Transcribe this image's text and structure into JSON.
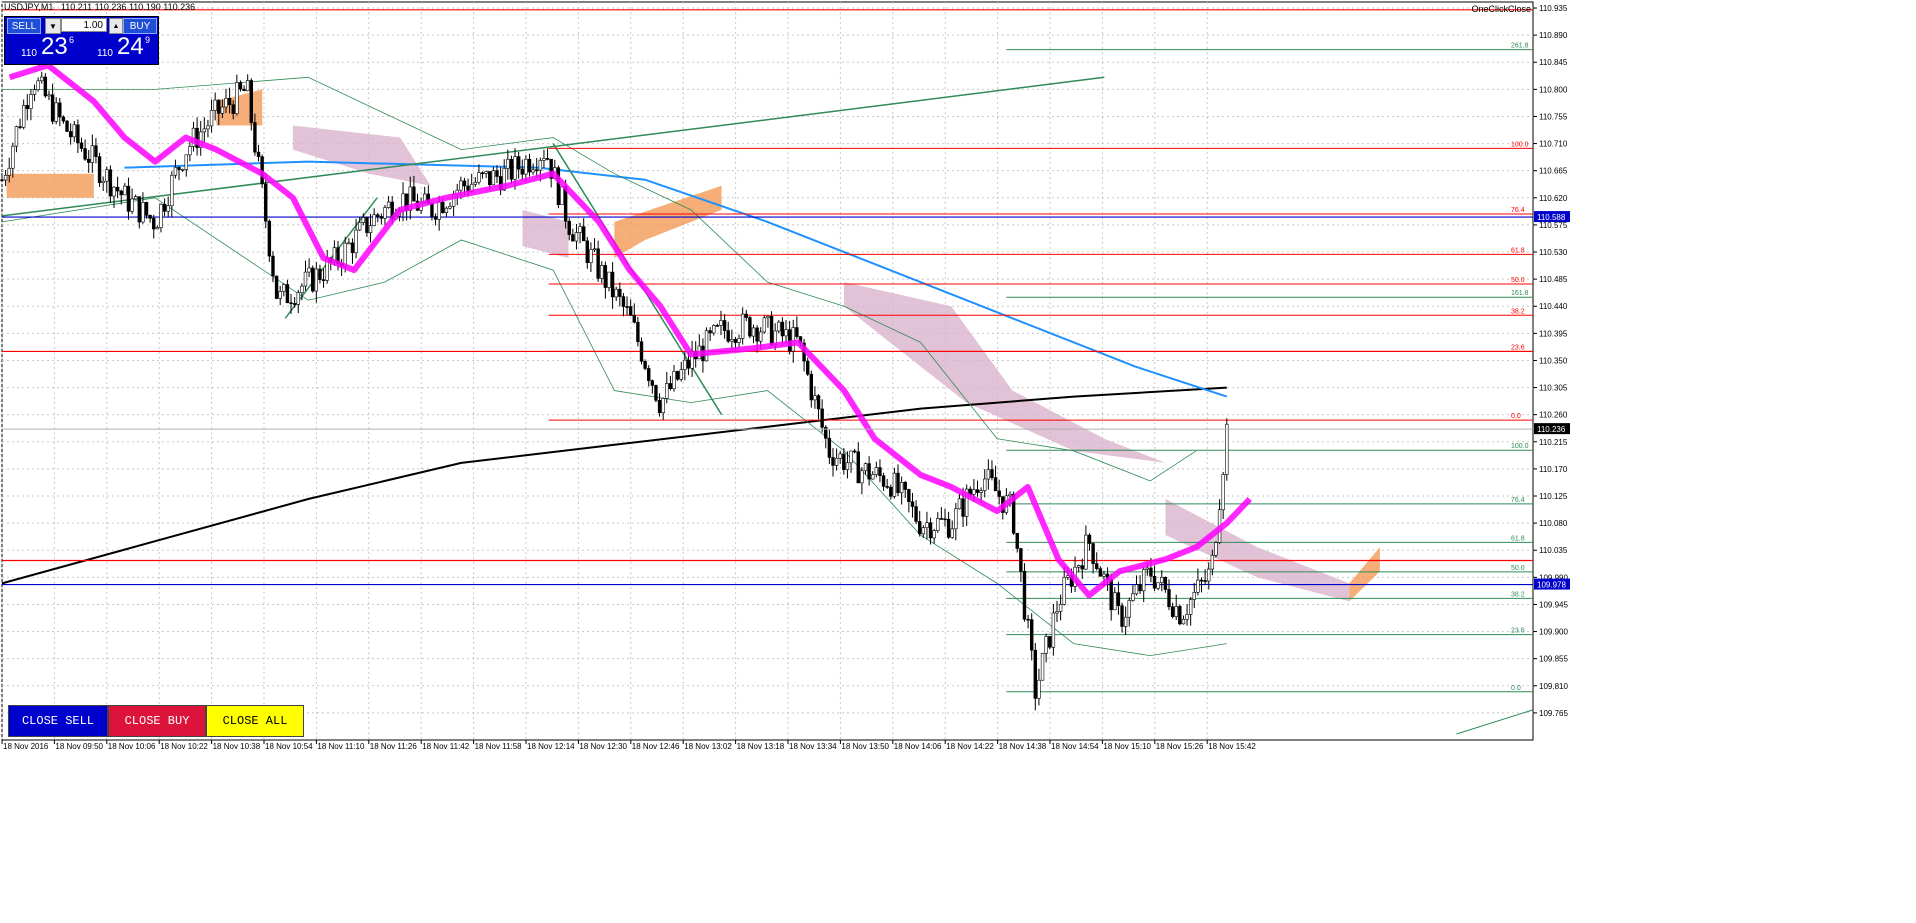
{
  "header": {
    "symbol": "USDJPY,M1",
    "ohlc": "110.211 110.236 110.190 110.236"
  },
  "one_click_label": "OneClickClose",
  "trade_panel": {
    "sell_label": "SELL",
    "buy_label": "BUY",
    "lot": "1.00",
    "dropdown_glyph": "▼",
    "up_glyph": "▲",
    "sell_small": "110",
    "sell_big": "23",
    "sell_sup": "6",
    "buy_small": "110",
    "buy_big": "24",
    "buy_sup": "9"
  },
  "buttons": {
    "close_sell": "CLOSE SELL",
    "close_buy": "CLOSE BUY",
    "close_all": "CLOSE ALL"
  },
  "colors": {
    "sell": "#0000cc",
    "close_buy": "#dc143c",
    "close_all": "#ffff00",
    "bid_line": "#0000cc"
  },
  "chart_data": {
    "type": "candlestick",
    "symbol": "USDJPY",
    "timeframe": "M1",
    "ylim": [
      109.72,
      110.945
    ],
    "grid": true,
    "y_ticks": [
      "110.935",
      "110.890",
      "110.845",
      "110.800",
      "110.755",
      "110.710",
      "110.665",
      "110.620",
      "110.575",
      "110.530",
      "110.485",
      "110.440",
      "110.395",
      "110.350",
      "110.305",
      "110.260",
      "110.215",
      "110.170",
      "110.125",
      "110.080",
      "110.035",
      "109.990",
      "109.945",
      "109.900",
      "109.855",
      "109.810",
      "109.765"
    ],
    "x_ticks": [
      "18 Nov 2016",
      "18 Nov 09:50",
      "18 Nov 10:06",
      "18 Nov 10:22",
      "18 Nov 10:38",
      "18 Nov 10:54",
      "18 Nov 11:10",
      "18 Nov 11:26",
      "18 Nov 11:42",
      "18 Nov 11:58",
      "18 Nov 12:14",
      "18 Nov 12:30",
      "18 Nov 12:46",
      "18 Nov 13:02",
      "18 Nov 13:18",
      "18 Nov 13:34",
      "18 Nov 13:50",
      "18 Nov 14:06",
      "18 Nov 14:22",
      "18 Nov 14:38",
      "18 Nov 14:54",
      "18 Nov 15:10",
      "18 Nov 15:26",
      "18 Nov 15:42"
    ],
    "current_price": "110.236",
    "price_labels": [
      {
        "value": 110.588,
        "label": "110.588",
        "color": "#0000cc"
      },
      {
        "value": 109.978,
        "label": "109.978",
        "color": "#0000cc"
      },
      {
        "value": 110.236,
        "label": "110.236",
        "color": "#000000"
      }
    ],
    "horizontal_lines": [
      {
        "value": 110.932,
        "color": "#ff0000"
      },
      {
        "value": 110.365,
        "color": "#ff0000"
      },
      {
        "value": 110.018,
        "color": "#ff0000"
      },
      {
        "value": 110.588,
        "color": "#0000cc"
      },
      {
        "value": 109.978,
        "color": "#0000cc"
      }
    ],
    "fib_red": {
      "levels": [
        {
          "label": "100.0",
          "value": 110.702
        },
        {
          "label": "76.4",
          "value": 110.593
        },
        {
          "label": "61.8",
          "value": 110.526
        },
        {
          "label": "50.0",
          "value": 110.477
        },
        {
          "label": "38.2",
          "value": 110.425
        },
        {
          "label": "23.6",
          "value": 110.365
        },
        {
          "label": "0.0",
          "value": 110.251
        }
      ]
    },
    "fib_green": {
      "levels": [
        {
          "label": "261.8",
          "value": 110.866
        },
        {
          "label": "161.8",
          "value": 110.455
        },
        {
          "label": "100.0",
          "value": 110.201
        },
        {
          "label": "76.4",
          "value": 110.112
        },
        {
          "label": "61.8",
          "value": 110.048
        },
        {
          "label": "50.0",
          "value": 109.999
        },
        {
          "label": "38.2",
          "value": 109.955
        },
        {
          "label": "23.6",
          "value": 109.895
        },
        {
          "label": "0.0",
          "value": 109.8
        }
      ]
    },
    "close_path": [
      [
        0.0,
        110.65
      ],
      [
        0.02,
        110.82
      ],
      [
        0.04,
        110.74
      ],
      [
        0.06,
        110.68
      ],
      [
        0.08,
        110.62
      ],
      [
        0.1,
        110.58
      ],
      [
        0.12,
        110.7
      ],
      [
        0.14,
        110.76
      ],
      [
        0.16,
        110.8
      ],
      [
        0.18,
        110.45
      ],
      [
        0.2,
        110.48
      ],
      [
        0.22,
        110.52
      ],
      [
        0.24,
        110.58
      ],
      [
        0.26,
        110.62
      ],
      [
        0.28,
        110.6
      ],
      [
        0.3,
        110.64
      ],
      [
        0.33,
        110.66
      ],
      [
        0.355,
        110.7
      ],
      [
        0.37,
        110.58
      ],
      [
        0.39,
        110.5
      ],
      [
        0.41,
        110.42
      ],
      [
        0.43,
        110.28
      ],
      [
        0.45,
        110.35
      ],
      [
        0.47,
        110.4
      ],
      [
        0.49,
        110.41
      ],
      [
        0.52,
        110.38
      ],
      [
        0.54,
        110.2
      ],
      [
        0.56,
        110.17
      ],
      [
        0.58,
        110.15
      ],
      [
        0.6,
        110.08
      ],
      [
        0.62,
        110.08
      ],
      [
        0.64,
        110.16
      ],
      [
        0.66,
        110.1
      ],
      [
        0.675,
        109.8
      ],
      [
        0.69,
        109.95
      ],
      [
        0.71,
        110.05
      ],
      [
        0.73,
        109.92
      ],
      [
        0.75,
        110.0
      ],
      [
        0.77,
        109.93
      ],
      [
        0.79,
        110.0
      ],
      [
        0.8,
        110.236
      ]
    ],
    "overlays": [
      "Ichimoku cloud",
      "Bollinger Bands",
      "Moving averages"
    ]
  }
}
